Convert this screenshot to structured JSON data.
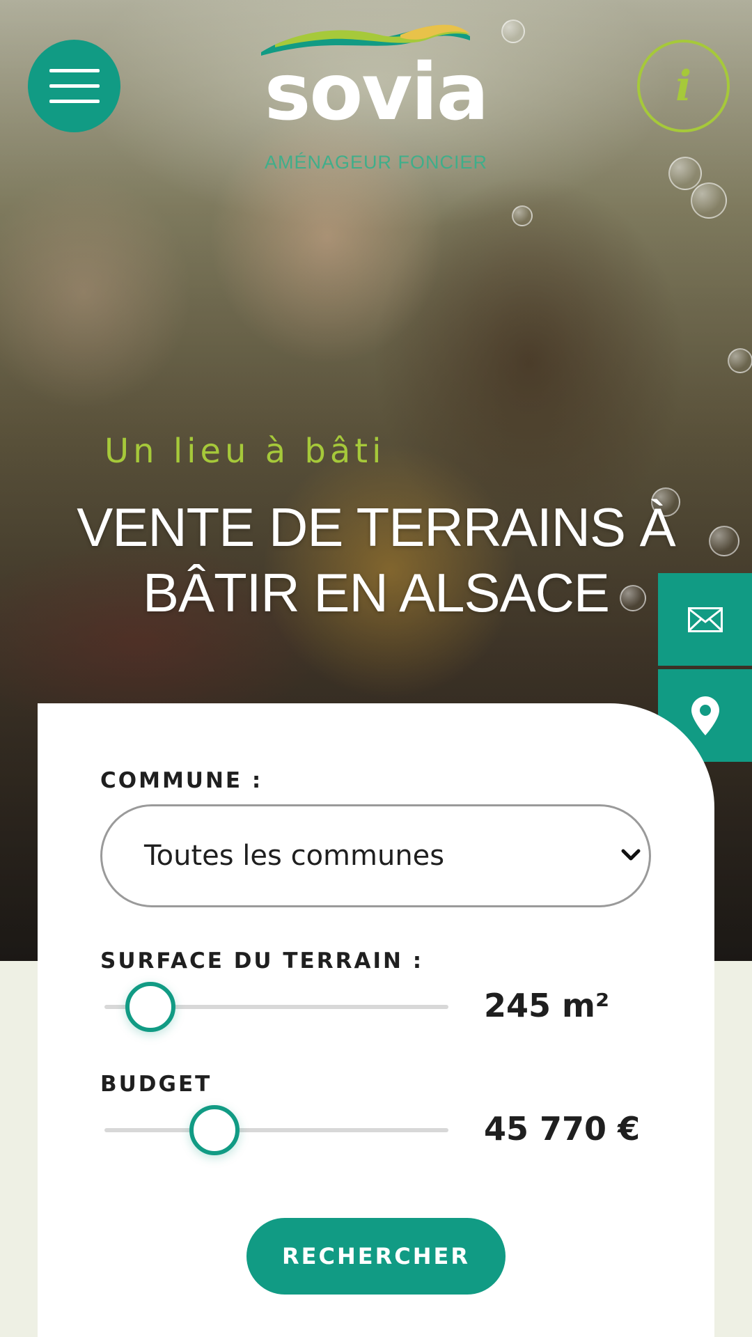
{
  "header": {
    "menu_icon": "hamburger-menu-icon",
    "info_icon": "info-icon",
    "logo": {
      "name": "sovia",
      "subtitle": "AMÉNAGEUR FONCIER"
    }
  },
  "hero": {
    "tagline": "Un lieu à bâti",
    "headline_line1": "VENTE DE TERRAINS À",
    "headline_line2": "BÂTIR EN ALSACE"
  },
  "side_actions": {
    "mail_icon": "envelope-icon",
    "location_icon": "map-pin-icon"
  },
  "search": {
    "commune_label": "COMMUNE :",
    "commune_value": "Toutes les communes",
    "surface_label": "SURFACE DU TERRAIN :",
    "surface_value": "245 m²",
    "surface_fraction": 0.07,
    "budget_label": "BUDGET",
    "budget_value": "45 770 €",
    "budget_fraction": 0.29,
    "button_label": "RECHERCHER"
  },
  "colors": {
    "primary": "#119b84",
    "accent": "#a6c93a",
    "background": "#eef0e4"
  }
}
